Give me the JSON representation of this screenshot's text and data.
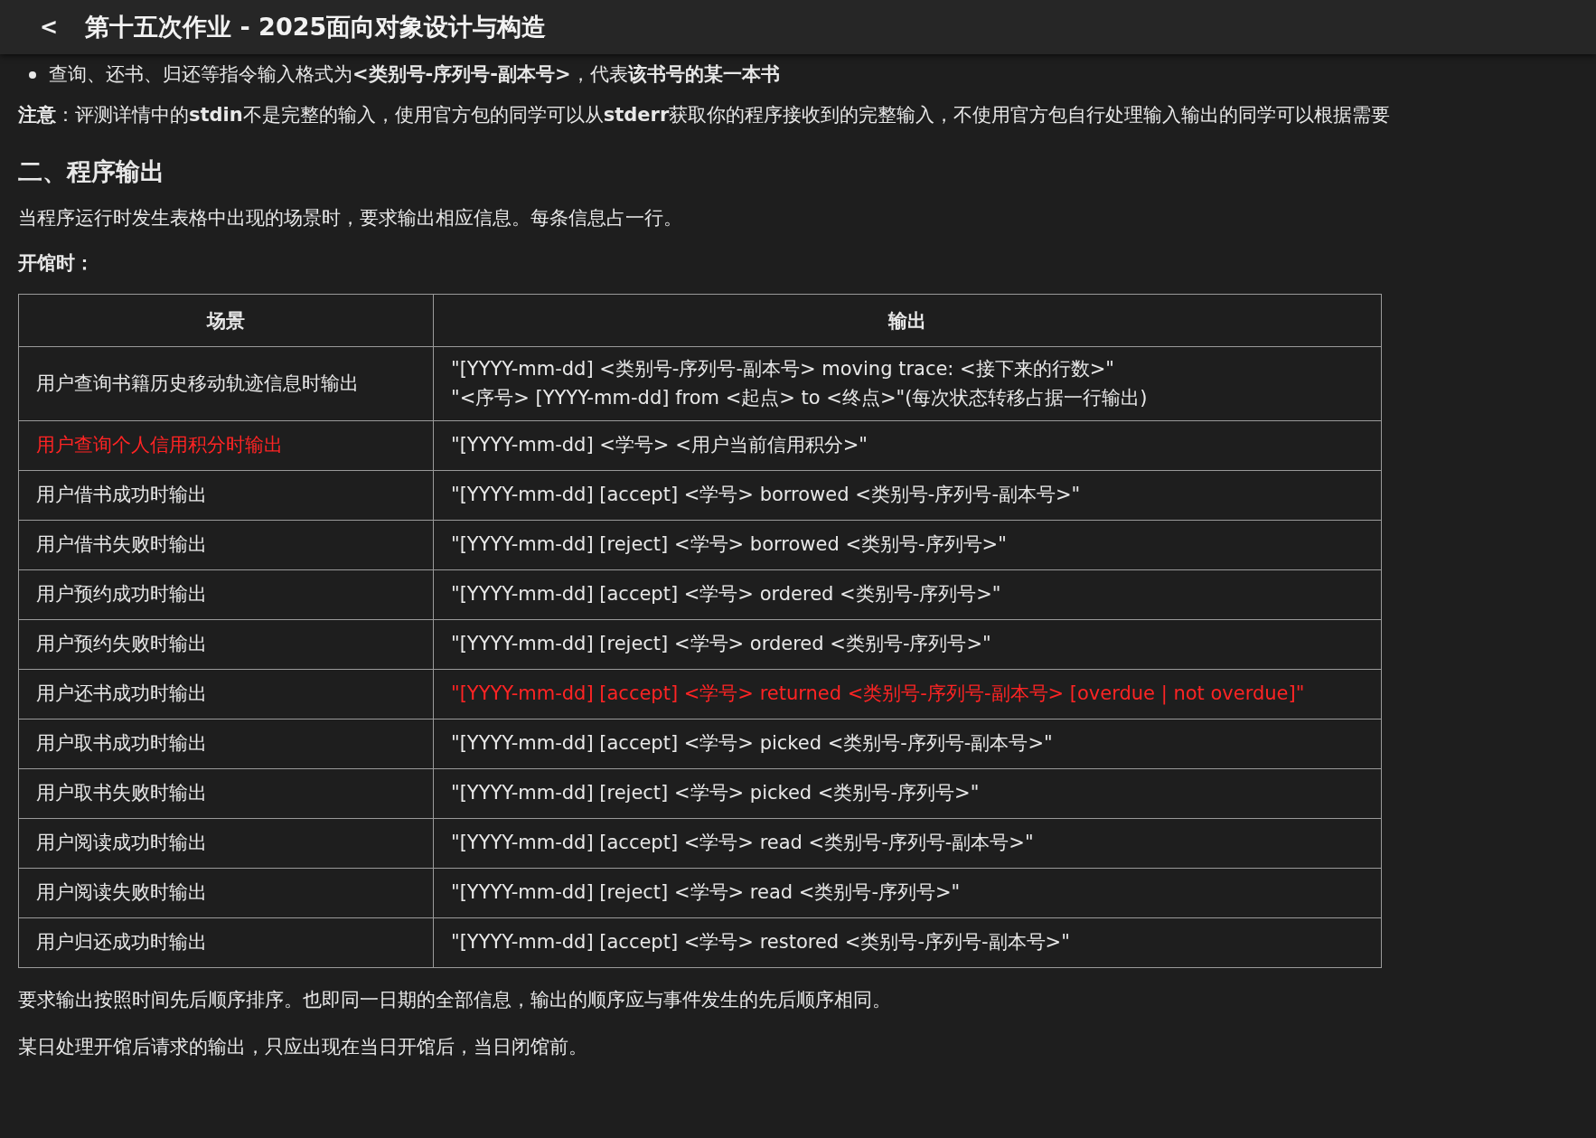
{
  "header": {
    "back": "<",
    "title": "第十五次作业 - 2025面向对象设计与构造"
  },
  "bullet": "查询、还书、归还等指令输入格式为**<类别号-序列号-副本号>**，代表**该书号的某一本书**",
  "note": "**注意**：评测详情中的**stdin**不是完整的输入，使用官方包的同学可以从**stderr**获取你的程序接收到的完整输入，不使用官方包自行处理输入输出的同学可以根据需要",
  "section_heading": "二、程序输出",
  "intro": "当程序运行时发生表格中出现的场景时，要求输出相应信息。每条信息占一行。",
  "subheading": "开馆时：",
  "table": {
    "columns": [
      "场景",
      "输出"
    ],
    "rows": [
      {
        "scene": "用户查询书籍历史移动轨迹信息时输出",
        "scene_emphasized": false,
        "output": [
          "\"[YYYY-mm-dd] <类别号-序列号-副本号> moving trace: <接下来的行数>\"",
          "\"<序号> [YYYY-mm-dd] from <起点> to <终点>\"(每次状态转移占据一行输出)"
        ],
        "output_emphasized": false
      },
      {
        "scene": "用户查询个人信用积分时输出",
        "scene_emphasized": true,
        "output": [
          "\"[YYYY-mm-dd] <学号> <用户当前信用积分>\""
        ],
        "output_emphasized": false
      },
      {
        "scene": "用户借书成功时输出",
        "scene_emphasized": false,
        "output": [
          "\"[YYYY-mm-dd] [accept] <学号> borrowed <类别号-序列号-副本号>\""
        ],
        "output_emphasized": false
      },
      {
        "scene": "用户借书失败时输出",
        "scene_emphasized": false,
        "output": [
          "\"[YYYY-mm-dd] [reject] <学号> borrowed <类别号-序列号>\""
        ],
        "output_emphasized": false
      },
      {
        "scene": "用户预约成功时输出",
        "scene_emphasized": false,
        "output": [
          "\"[YYYY-mm-dd] [accept] <学号> ordered <类别号-序列号>\""
        ],
        "output_emphasized": false
      },
      {
        "scene": "用户预约失败时输出",
        "scene_emphasized": false,
        "output": [
          "\"[YYYY-mm-dd] [reject] <学号> ordered <类别号-序列号>\""
        ],
        "output_emphasized": false
      },
      {
        "scene": "用户还书成功时输出",
        "scene_emphasized": false,
        "output": [
          "\"[YYYY-mm-dd] [accept] <学号> returned <类别号-序列号-副本号> [overdue | not overdue]\""
        ],
        "output_emphasized": true
      },
      {
        "scene": "用户取书成功时输出",
        "scene_emphasized": false,
        "output": [
          "\"[YYYY-mm-dd] [accept] <学号> picked <类别号-序列号-副本号>\""
        ],
        "output_emphasized": false
      },
      {
        "scene": "用户取书失败时输出",
        "scene_emphasized": false,
        "output": [
          "\"[YYYY-mm-dd] [reject] <学号> picked <类别号-序列号>\""
        ],
        "output_emphasized": false
      },
      {
        "scene": "用户阅读成功时输出",
        "scene_emphasized": false,
        "output": [
          "\"[YYYY-mm-dd] [accept] <学号> read <类别号-序列号-副本号>\""
        ],
        "output_emphasized": false
      },
      {
        "scene": "用户阅读失败时输出",
        "scene_emphasized": false,
        "output": [
          "\"[YYYY-mm-dd] [reject] <学号> read <类别号-序列号>\""
        ],
        "output_emphasized": false
      },
      {
        "scene": "用户归还成功时输出",
        "scene_emphasized": false,
        "output": [
          "\"[YYYY-mm-dd] [accept] <学号> restored <类别号-序列号-副本号>\""
        ],
        "output_emphasized": false
      }
    ]
  },
  "paragraphs": [
    "要求输出按照时间先后顺序排序。也即同一日期的全部信息，输出的顺序应与事件发生的先后顺序相同。",
    "某日处理开馆后请求的输出，只应出现在当日开馆后，当日闭馆前。"
  ]
}
